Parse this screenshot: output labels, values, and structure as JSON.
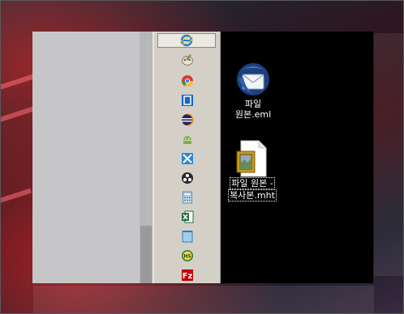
{
  "toolbar_icons": [
    "internet-explorer-icon",
    "paint-palette-icon",
    "chrome-icon",
    "blue-frame-app-icon",
    "eclipse-icon",
    "android-icon",
    "xcode-tool-icon",
    "obs-icon",
    "calculator-icon",
    "excel-icon",
    "notepad-icon",
    "hs-app-icon",
    "filezilla-icon"
  ],
  "desktop": {
    "eml": {
      "label_line1": "파일",
      "label_line2": "원본.eml"
    },
    "mht": {
      "label_line1": "파일 원본 -",
      "label_line2": "복사본.mht"
    }
  },
  "colors": {
    "desktop_bg": "#000000",
    "pane_bg": "#c6c6c8",
    "toolbar_bg": "#d4d0c8"
  }
}
